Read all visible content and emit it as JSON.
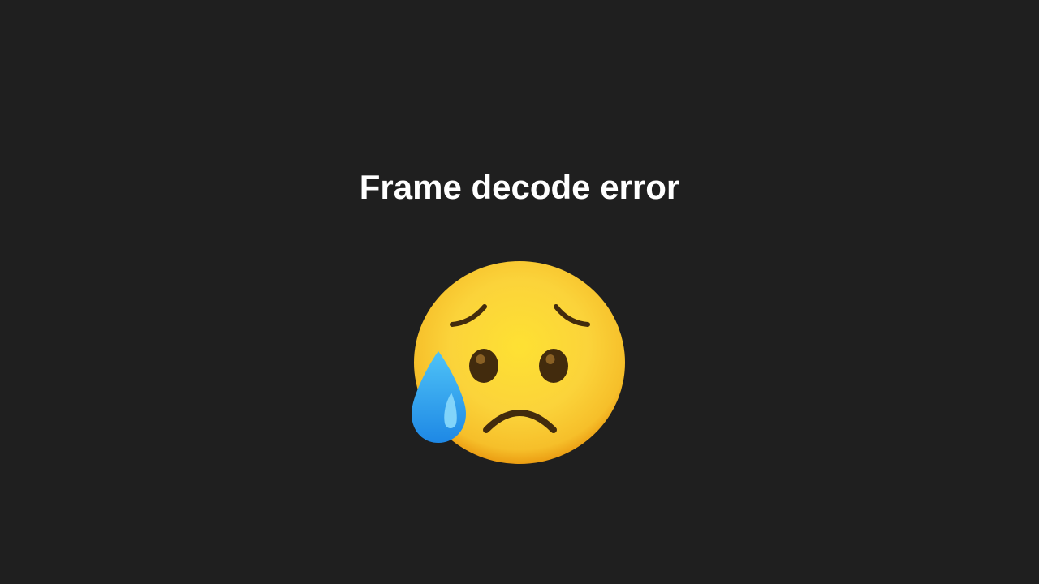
{
  "error": {
    "title": "Frame decode error"
  },
  "icon": {
    "name": "sad-but-relieved-face-icon",
    "face_color": "#fbd33a",
    "face_shadow_color": "#e8930c",
    "feature_color": "#422b0d",
    "tear_color": "#29a6ec",
    "tear_highlight_color": "#81d4fa"
  },
  "colors": {
    "background": "#1f1f1f",
    "text": "#ffffff"
  }
}
